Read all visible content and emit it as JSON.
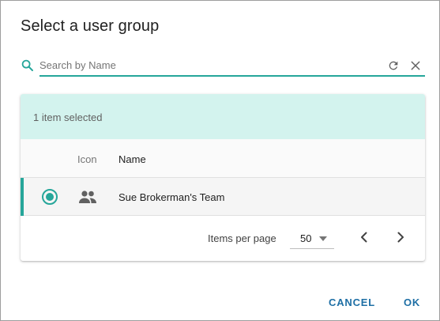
{
  "dialog": {
    "title": "Select a user group"
  },
  "search": {
    "placeholder": "Search by Name",
    "value": ""
  },
  "table": {
    "selection_text": "1 item selected",
    "columns": {
      "icon": "Icon",
      "name": "Name"
    },
    "rows": [
      {
        "name": "Sue Brokerman's Team",
        "selected": true,
        "icon": "group-icon"
      }
    ]
  },
  "pagination": {
    "items_per_page_label": "Items per page",
    "items_per_page_value": "50"
  },
  "actions": {
    "cancel_label": "CANCEL",
    "ok_label": "OK"
  },
  "colors": {
    "accent": "#26a69a",
    "selection_banner": "#d3f3ee",
    "button_text": "#1e6fa5"
  }
}
